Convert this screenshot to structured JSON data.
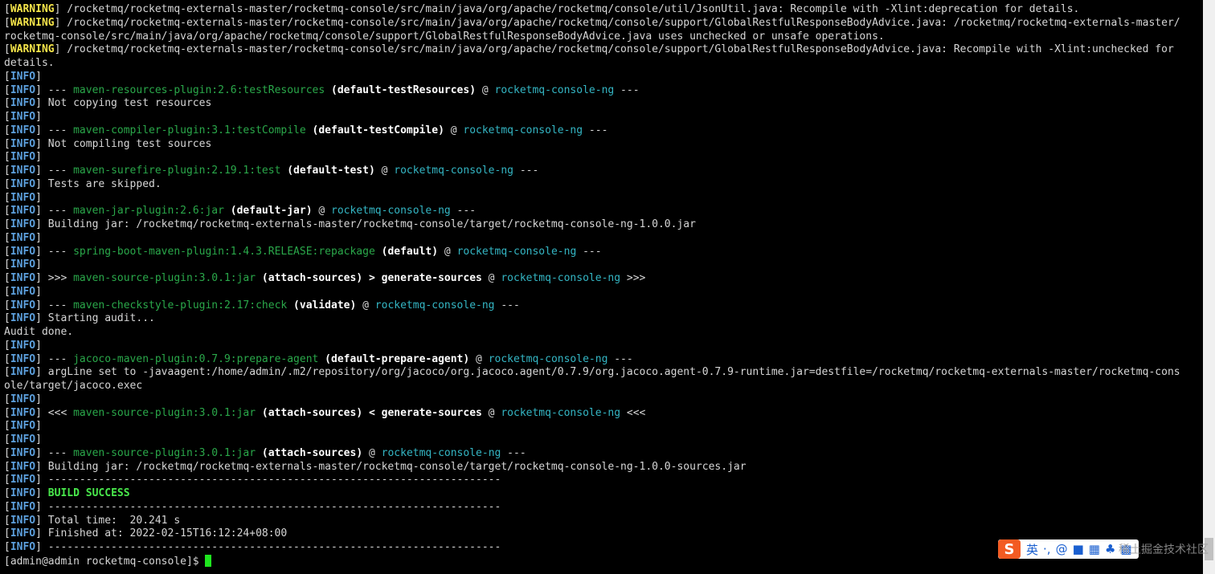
{
  "terminal": {
    "lines": [
      [
        {
          "t": "[",
          "c": "seg-plain"
        },
        {
          "t": "WARNING",
          "c": "seg-warn"
        },
        {
          "t": "] /rocketmq/rocketmq-externals-master/rocketmq-console/src/main/java/org/apache/rocketmq/console/util/JsonUtil.java: Recompile with -Xlint:deprecation for details.",
          "c": "seg-plain"
        }
      ],
      [
        {
          "t": "[",
          "c": "seg-plain"
        },
        {
          "t": "WARNING",
          "c": "seg-warn"
        },
        {
          "t": "] /rocketmq/rocketmq-externals-master/rocketmq-console/src/main/java/org/apache/rocketmq/console/support/GlobalRestfulResponseBodyAdvice.java: /rocketmq/rocketmq-externals-master/",
          "c": "seg-plain"
        }
      ],
      [
        {
          "t": "rocketmq-console/src/main/java/org/apache/rocketmq/console/support/GlobalRestfulResponseBodyAdvice.java uses unchecked or unsafe operations.",
          "c": "seg-plain"
        }
      ],
      [
        {
          "t": "[",
          "c": "seg-plain"
        },
        {
          "t": "WARNING",
          "c": "seg-warn"
        },
        {
          "t": "] /rocketmq/rocketmq-externals-master/rocketmq-console/src/main/java/org/apache/rocketmq/console/support/GlobalRestfulResponseBodyAdvice.java: Recompile with -Xlint:unchecked for",
          "c": "seg-plain"
        }
      ],
      [
        {
          "t": "details.",
          "c": "seg-plain"
        }
      ],
      [
        {
          "t": "[",
          "c": "seg-plain"
        },
        {
          "t": "INFO",
          "c": "seg-info"
        },
        {
          "t": "]",
          "c": "seg-plain"
        }
      ],
      [
        {
          "t": "[",
          "c": "seg-plain"
        },
        {
          "t": "INFO",
          "c": "seg-info"
        },
        {
          "t": "] --- ",
          "c": "seg-plain"
        },
        {
          "t": "maven-resources-plugin:2.6:testResources",
          "c": "seg-plugin"
        },
        {
          "t": " (default-testResources)",
          "c": "seg-bold"
        },
        {
          "t": " @ ",
          "c": "seg-plain"
        },
        {
          "t": "rocketmq-console-ng",
          "c": "seg-project"
        },
        {
          "t": " ---",
          "c": "seg-plain"
        }
      ],
      [
        {
          "t": "[",
          "c": "seg-plain"
        },
        {
          "t": "INFO",
          "c": "seg-info"
        },
        {
          "t": "] Not copying test resources",
          "c": "seg-plain"
        }
      ],
      [
        {
          "t": "[",
          "c": "seg-plain"
        },
        {
          "t": "INFO",
          "c": "seg-info"
        },
        {
          "t": "]",
          "c": "seg-plain"
        }
      ],
      [
        {
          "t": "[",
          "c": "seg-plain"
        },
        {
          "t": "INFO",
          "c": "seg-info"
        },
        {
          "t": "] --- ",
          "c": "seg-plain"
        },
        {
          "t": "maven-compiler-plugin:3.1:testCompile",
          "c": "seg-plugin"
        },
        {
          "t": " (default-testCompile)",
          "c": "seg-bold"
        },
        {
          "t": " @ ",
          "c": "seg-plain"
        },
        {
          "t": "rocketmq-console-ng",
          "c": "seg-project"
        },
        {
          "t": " ---",
          "c": "seg-plain"
        }
      ],
      [
        {
          "t": "[",
          "c": "seg-plain"
        },
        {
          "t": "INFO",
          "c": "seg-info"
        },
        {
          "t": "] Not compiling test sources",
          "c": "seg-plain"
        }
      ],
      [
        {
          "t": "[",
          "c": "seg-plain"
        },
        {
          "t": "INFO",
          "c": "seg-info"
        },
        {
          "t": "]",
          "c": "seg-plain"
        }
      ],
      [
        {
          "t": "[",
          "c": "seg-plain"
        },
        {
          "t": "INFO",
          "c": "seg-info"
        },
        {
          "t": "] --- ",
          "c": "seg-plain"
        },
        {
          "t": "maven-surefire-plugin:2.19.1:test",
          "c": "seg-plugin"
        },
        {
          "t": " (default-test)",
          "c": "seg-bold"
        },
        {
          "t": " @ ",
          "c": "seg-plain"
        },
        {
          "t": "rocketmq-console-ng",
          "c": "seg-project"
        },
        {
          "t": " ---",
          "c": "seg-plain"
        }
      ],
      [
        {
          "t": "[",
          "c": "seg-plain"
        },
        {
          "t": "INFO",
          "c": "seg-info"
        },
        {
          "t": "] Tests are skipped.",
          "c": "seg-plain"
        }
      ],
      [
        {
          "t": "[",
          "c": "seg-plain"
        },
        {
          "t": "INFO",
          "c": "seg-info"
        },
        {
          "t": "]",
          "c": "seg-plain"
        }
      ],
      [
        {
          "t": "[",
          "c": "seg-plain"
        },
        {
          "t": "INFO",
          "c": "seg-info"
        },
        {
          "t": "] --- ",
          "c": "seg-plain"
        },
        {
          "t": "maven-jar-plugin:2.6:jar",
          "c": "seg-plugin"
        },
        {
          "t": " (default-jar)",
          "c": "seg-bold"
        },
        {
          "t": " @ ",
          "c": "seg-plain"
        },
        {
          "t": "rocketmq-console-ng",
          "c": "seg-project"
        },
        {
          "t": " ---",
          "c": "seg-plain"
        }
      ],
      [
        {
          "t": "[",
          "c": "seg-plain"
        },
        {
          "t": "INFO",
          "c": "seg-info"
        },
        {
          "t": "] Building jar: /rocketmq/rocketmq-externals-master/rocketmq-console/target/rocketmq-console-ng-1.0.0.jar",
          "c": "seg-plain"
        }
      ],
      [
        {
          "t": "[",
          "c": "seg-plain"
        },
        {
          "t": "INFO",
          "c": "seg-info"
        },
        {
          "t": "]",
          "c": "seg-plain"
        }
      ],
      [
        {
          "t": "[",
          "c": "seg-plain"
        },
        {
          "t": "INFO",
          "c": "seg-info"
        },
        {
          "t": "] --- ",
          "c": "seg-plain"
        },
        {
          "t": "spring-boot-maven-plugin:1.4.3.RELEASE:repackage",
          "c": "seg-plugin"
        },
        {
          "t": " (default)",
          "c": "seg-bold"
        },
        {
          "t": " @ ",
          "c": "seg-plain"
        },
        {
          "t": "rocketmq-console-ng",
          "c": "seg-project"
        },
        {
          "t": " ---",
          "c": "seg-plain"
        }
      ],
      [
        {
          "t": "[",
          "c": "seg-plain"
        },
        {
          "t": "INFO",
          "c": "seg-info"
        },
        {
          "t": "]",
          "c": "seg-plain"
        }
      ],
      [
        {
          "t": "[",
          "c": "seg-plain"
        },
        {
          "t": "INFO",
          "c": "seg-info"
        },
        {
          "t": "] >>> ",
          "c": "seg-plain"
        },
        {
          "t": "maven-source-plugin:3.0.1:jar",
          "c": "seg-plugin"
        },
        {
          "t": " (attach-sources) > generate-sources",
          "c": "seg-bold"
        },
        {
          "t": " @ ",
          "c": "seg-plain"
        },
        {
          "t": "rocketmq-console-ng",
          "c": "seg-project"
        },
        {
          "t": " >>>",
          "c": "seg-plain"
        }
      ],
      [
        {
          "t": "[",
          "c": "seg-plain"
        },
        {
          "t": "INFO",
          "c": "seg-info"
        },
        {
          "t": "]",
          "c": "seg-plain"
        }
      ],
      [
        {
          "t": "[",
          "c": "seg-plain"
        },
        {
          "t": "INFO",
          "c": "seg-info"
        },
        {
          "t": "] --- ",
          "c": "seg-plain"
        },
        {
          "t": "maven-checkstyle-plugin:2.17:check",
          "c": "seg-plugin"
        },
        {
          "t": " (validate)",
          "c": "seg-bold"
        },
        {
          "t": " @ ",
          "c": "seg-plain"
        },
        {
          "t": "rocketmq-console-ng",
          "c": "seg-project"
        },
        {
          "t": " ---",
          "c": "seg-plain"
        }
      ],
      [
        {
          "t": "[",
          "c": "seg-plain"
        },
        {
          "t": "INFO",
          "c": "seg-info"
        },
        {
          "t": "] Starting audit...",
          "c": "seg-plain"
        }
      ],
      [
        {
          "t": "Audit done.",
          "c": "seg-plain"
        }
      ],
      [
        {
          "t": "[",
          "c": "seg-plain"
        },
        {
          "t": "INFO",
          "c": "seg-info"
        },
        {
          "t": "]",
          "c": "seg-plain"
        }
      ],
      [
        {
          "t": "[",
          "c": "seg-plain"
        },
        {
          "t": "INFO",
          "c": "seg-info"
        },
        {
          "t": "] --- ",
          "c": "seg-plain"
        },
        {
          "t": "jacoco-maven-plugin:0.7.9:prepare-agent",
          "c": "seg-plugin"
        },
        {
          "t": " (default-prepare-agent)",
          "c": "seg-bold"
        },
        {
          "t": " @ ",
          "c": "seg-plain"
        },
        {
          "t": "rocketmq-console-ng",
          "c": "seg-project"
        },
        {
          "t": " ---",
          "c": "seg-plain"
        }
      ],
      [
        {
          "t": "[",
          "c": "seg-plain"
        },
        {
          "t": "INFO",
          "c": "seg-info"
        },
        {
          "t": "] argLine set to -javaagent:/home/admin/.m2/repository/org/jacoco/org.jacoco.agent/0.7.9/org.jacoco.agent-0.7.9-runtime.jar=destfile=/rocketmq/rocketmq-externals-master/rocketmq-cons",
          "c": "seg-plain"
        }
      ],
      [
        {
          "t": "ole/target/jacoco.exec",
          "c": "seg-plain"
        }
      ],
      [
        {
          "t": "[",
          "c": "seg-plain"
        },
        {
          "t": "INFO",
          "c": "seg-info"
        },
        {
          "t": "]",
          "c": "seg-plain"
        }
      ],
      [
        {
          "t": "[",
          "c": "seg-plain"
        },
        {
          "t": "INFO",
          "c": "seg-info"
        },
        {
          "t": "] <<< ",
          "c": "seg-plain"
        },
        {
          "t": "maven-source-plugin:3.0.1:jar",
          "c": "seg-plugin"
        },
        {
          "t": " (attach-sources) < generate-sources",
          "c": "seg-bold"
        },
        {
          "t": " @ ",
          "c": "seg-plain"
        },
        {
          "t": "rocketmq-console-ng",
          "c": "seg-project"
        },
        {
          "t": " <<<",
          "c": "seg-plain"
        }
      ],
      [
        {
          "t": "[",
          "c": "seg-plain"
        },
        {
          "t": "INFO",
          "c": "seg-info"
        },
        {
          "t": "]",
          "c": "seg-plain"
        }
      ],
      [
        {
          "t": "[",
          "c": "seg-plain"
        },
        {
          "t": "INFO",
          "c": "seg-info"
        },
        {
          "t": "]",
          "c": "seg-plain"
        }
      ],
      [
        {
          "t": "[",
          "c": "seg-plain"
        },
        {
          "t": "INFO",
          "c": "seg-info"
        },
        {
          "t": "] --- ",
          "c": "seg-plain"
        },
        {
          "t": "maven-source-plugin:3.0.1:jar",
          "c": "seg-plugin"
        },
        {
          "t": " (attach-sources)",
          "c": "seg-bold"
        },
        {
          "t": " @ ",
          "c": "seg-plain"
        },
        {
          "t": "rocketmq-console-ng",
          "c": "seg-project"
        },
        {
          "t": " ---",
          "c": "seg-plain"
        }
      ],
      [
        {
          "t": "[",
          "c": "seg-plain"
        },
        {
          "t": "INFO",
          "c": "seg-info"
        },
        {
          "t": "] Building jar: /rocketmq/rocketmq-externals-master/rocketmq-console/target/rocketmq-console-ng-1.0.0-sources.jar",
          "c": "seg-plain"
        }
      ],
      [
        {
          "t": "[",
          "c": "seg-plain"
        },
        {
          "t": "INFO",
          "c": "seg-info"
        },
        {
          "t": "] ------------------------------------------------------------------------",
          "c": "seg-plain"
        }
      ],
      [
        {
          "t": "[",
          "c": "seg-plain"
        },
        {
          "t": "INFO",
          "c": "seg-info"
        },
        {
          "t": "] ",
          "c": "seg-plain"
        },
        {
          "t": "BUILD SUCCESS",
          "c": "seg-success"
        }
      ],
      [
        {
          "t": "[",
          "c": "seg-plain"
        },
        {
          "t": "INFO",
          "c": "seg-info"
        },
        {
          "t": "] ------------------------------------------------------------------------",
          "c": "seg-plain"
        }
      ],
      [
        {
          "t": "[",
          "c": "seg-plain"
        },
        {
          "t": "INFO",
          "c": "seg-info"
        },
        {
          "t": "] Total time:  20.241 s",
          "c": "seg-plain"
        }
      ],
      [
        {
          "t": "[",
          "c": "seg-plain"
        },
        {
          "t": "INFO",
          "c": "seg-info"
        },
        {
          "t": "] Finished at: 2022-02-15T16:12:24+08:00",
          "c": "seg-plain"
        }
      ],
      [
        {
          "t": "[",
          "c": "seg-plain"
        },
        {
          "t": "INFO",
          "c": "seg-info"
        },
        {
          "t": "] ------------------------------------------------------------------------",
          "c": "seg-plain"
        }
      ]
    ],
    "prompt": "[admin@admin rocketmq-console]$ "
  },
  "ime": {
    "logo": "S",
    "lang": "英",
    "punct": "·,",
    "items": [
      "@",
      "■",
      "▦",
      "♣",
      "▩"
    ]
  },
  "watermark": "稀土掘金技术社区",
  "colors": {
    "background": "#000000",
    "warning": "#f5e44a",
    "info": "#5c9fdc",
    "plugin": "#2aa84a",
    "project": "#34b6c4",
    "success": "#49e94c",
    "cursor": "#1ee61e"
  }
}
